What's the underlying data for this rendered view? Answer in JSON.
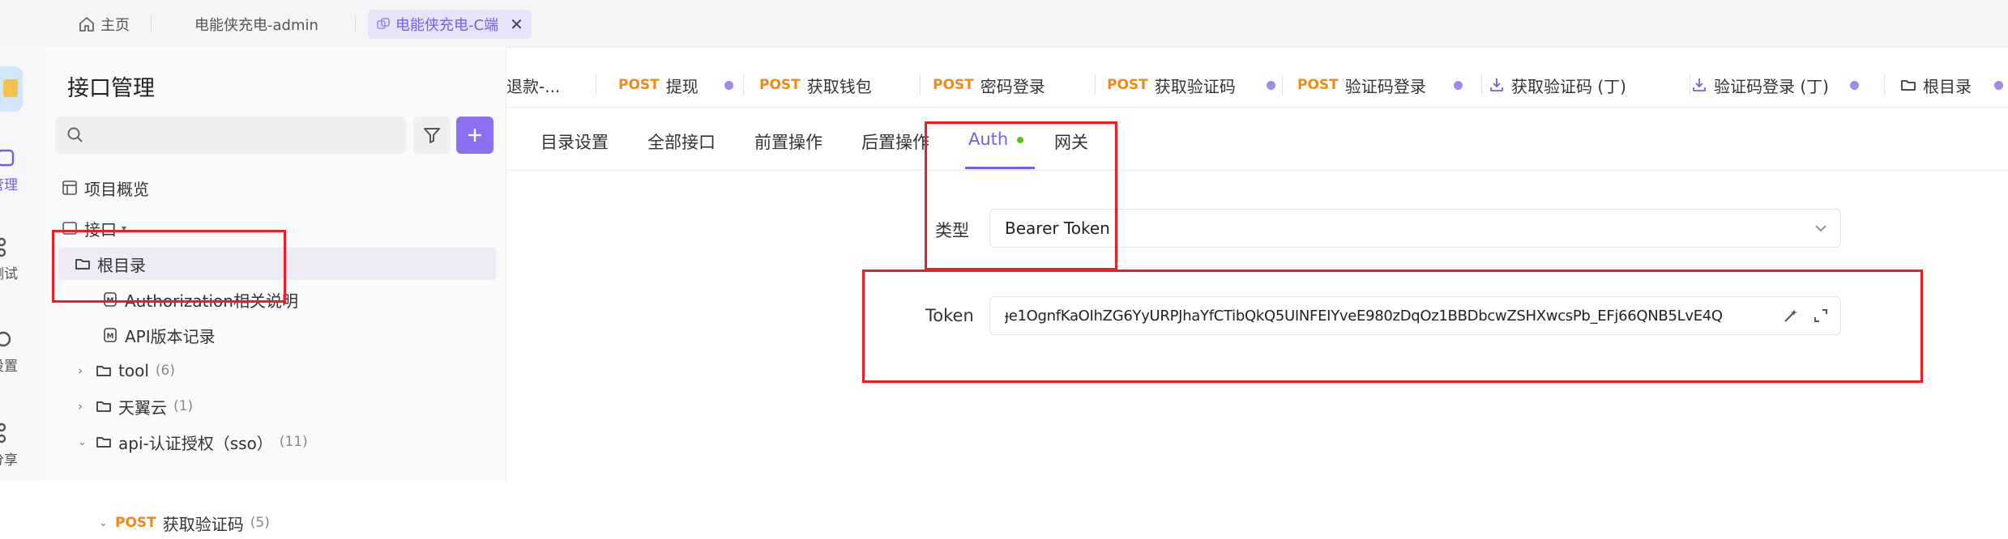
{
  "window_tabs": {
    "home": "主页",
    "admin": "电能侠充电-admin",
    "client": "电能侠充电-C端"
  },
  "rail": {
    "item1": "管理",
    "item2": "测试",
    "item3": "设置",
    "item4": "分享"
  },
  "sidebar": {
    "title": "接口管理",
    "search_placeholder": "",
    "overview": "项目概览",
    "interfaces": "接口",
    "root": "根目录",
    "auth_doc": "Authorization相关说明",
    "api_version": "API版本记录",
    "tool": {
      "label": "tool",
      "count": "(6)"
    },
    "tianyi": {
      "label": "天翼云",
      "count": "(1)"
    },
    "sso": {
      "label": "api-认证授权（sso）",
      "count": "(11)"
    },
    "sso_child": {
      "method": "POST",
      "label": "获取验证码",
      "count": "(5)"
    }
  },
  "request_tabs": [
    {
      "method": "",
      "label": "退款-..."
    },
    {
      "method": "POST",
      "label": "提现"
    },
    {
      "method": "POST",
      "label": "获取钱包"
    },
    {
      "method": "POST",
      "label": "密码登录"
    },
    {
      "method": "POST",
      "label": "获取验证码"
    },
    {
      "method": "POST",
      "label": "验证码登录"
    },
    {
      "method": "",
      "label": "获取验证码 (丁)"
    },
    {
      "method": "",
      "label": "验证码登录 (丁)"
    },
    {
      "method": "",
      "label": "根目录"
    }
  ],
  "sub_tabs": {
    "dir_settings": "目录设置",
    "all_interfaces": "全部接口",
    "pre_ops": "前置操作",
    "post_ops": "后置操作",
    "auth": "Auth",
    "gateway": "网关"
  },
  "auth_form": {
    "type_label": "类型",
    "type_value": "Bearer Token",
    "token_label": "Token",
    "token_value": "ɟe1OgnfKaOIhZG6YyURPJhaYfCTibQkQ5UINFEIYveE980zDqOz1BBDbcwZSHXwcsPb_EFj66QNB5LvE4Q"
  },
  "colors": {
    "accent": "#7a5ce6",
    "post": "#f08a14",
    "highlight": "#e5202a",
    "auth_dot": "#52c41a"
  }
}
